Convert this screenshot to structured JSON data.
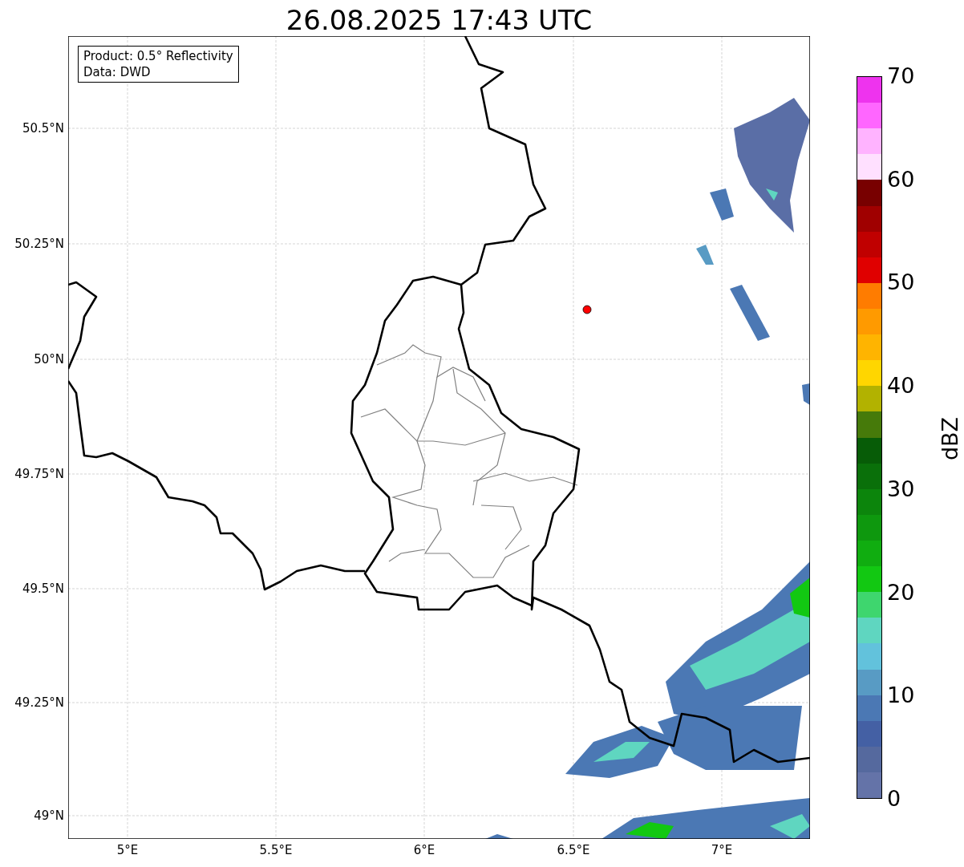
{
  "title": "26.08.2025 17:43 UTC",
  "info_box": [
    "Product: 0.5° Reflectivity",
    "Data: DWD"
  ],
  "lat_ticks": [
    "50.5°N",
    "50.25°N",
    "50°N",
    "49.75°N",
    "49.5°N",
    "49.25°N",
    "49°N"
  ],
  "lon_ticks": [
    "5°E",
    "5.5°E",
    "6°E",
    "6.5°E",
    "7°E"
  ],
  "colorbar": {
    "label": "dBZ",
    "segments": [
      {
        "color": "#ee33ee"
      },
      {
        "color": "#ff66ff"
      },
      {
        "color": "#ffb3ff"
      },
      {
        "color": "#ffe0ff"
      },
      {
        "color": "#780000"
      },
      {
        "color": "#a00000"
      },
      {
        "color": "#c00000"
      },
      {
        "color": "#e00000"
      },
      {
        "color": "#ff7c00"
      },
      {
        "color": "#ff9a00"
      },
      {
        "color": "#ffb400"
      },
      {
        "color": "#ffd600"
      },
      {
        "color": "#b2b200"
      },
      {
        "color": "#467a0a"
      },
      {
        "color": "#075c07"
      },
      {
        "color": "#0a700a"
      },
      {
        "color": "#0c850c"
      },
      {
        "color": "#0e980e"
      },
      {
        "color": "#10ad10"
      },
      {
        "color": "#12c812"
      },
      {
        "color": "#3ed66e"
      },
      {
        "color": "#5fd6c0"
      },
      {
        "color": "#62c2dc"
      },
      {
        "color": "#589bc4"
      },
      {
        "color": "#4b78b4"
      },
      {
        "color": "#4460a4"
      },
      {
        "color": "#55699e"
      },
      {
        "color": "#6473a8"
      }
    ],
    "ticks": [
      "70",
      "60",
      "50",
      "40",
      "30",
      "20",
      "10",
      "0"
    ]
  }
}
